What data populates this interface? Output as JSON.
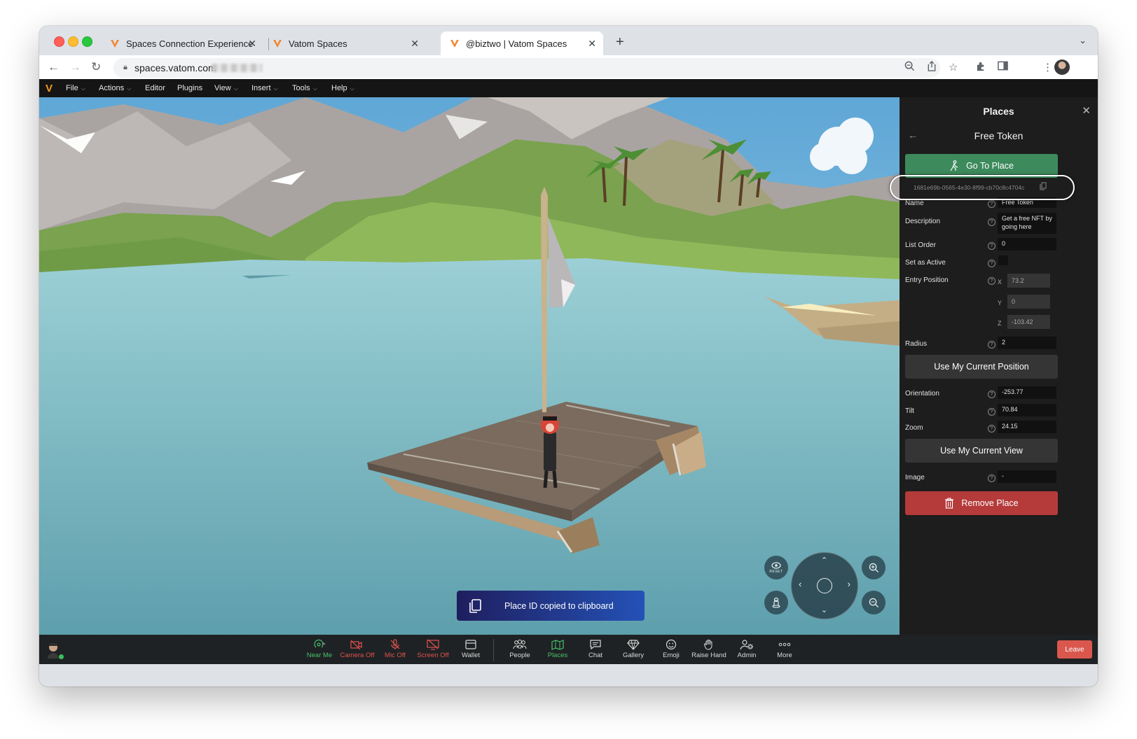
{
  "browser": {
    "tabs": [
      {
        "title": "Spaces Connection Experience",
        "active": false
      },
      {
        "title": "Vatom Spaces",
        "active": false
      },
      {
        "title": "@biztwo | Vatom Spaces",
        "active": true
      }
    ],
    "new_tab_label": "+",
    "url": "spaces.vatom.com"
  },
  "app_menu": {
    "items": [
      "File",
      "Actions",
      "Editor",
      "Plugins",
      "View",
      "Insert",
      "Tools",
      "Help"
    ]
  },
  "toast": {
    "text": "Place ID copied to clipboard"
  },
  "panel": {
    "title": "Places",
    "subtitle": "Free Token",
    "go_button": "Go To Place",
    "place_id": "1681e69b-0565-4e30-8f99-cb70c8c4704c",
    "fields": {
      "name_label": "Name",
      "name_value": "Free Token",
      "description_label": "Description",
      "description_value": "Get a free NFT by going here",
      "list_order_label": "List Order",
      "list_order_value": "0",
      "set_active_label": "Set as Active",
      "entry_position_label": "Entry Position",
      "x_label": "X",
      "x_value": "73.2",
      "y_label": "Y",
      "y_value": "0",
      "z_label": "Z",
      "z_value": "-103.42",
      "radius_label": "Radius",
      "radius_value": "2",
      "orientation_label": "Orientation",
      "orientation_value": "-253.77",
      "tilt_label": "Tilt",
      "tilt_value": "70.84",
      "zoom_label": "Zoom",
      "zoom_value": "24.15",
      "image_label": "Image",
      "image_value": "-"
    },
    "use_position_button": "Use My Current Position",
    "use_view_button": "Use My Current View",
    "remove_button": "Remove Place"
  },
  "bottom_bar": {
    "items": [
      {
        "label": "Near Me",
        "state": "on"
      },
      {
        "label": "Camera Off",
        "state": "off"
      },
      {
        "label": "Mic Off",
        "state": "off"
      },
      {
        "label": "Screen Off",
        "state": "off"
      },
      {
        "label": "Wallet",
        "state": "neutral"
      },
      {
        "label": "People",
        "state": "neutral"
      },
      {
        "label": "Places",
        "state": "on"
      },
      {
        "label": "Chat",
        "state": "neutral"
      },
      {
        "label": "Gallery",
        "state": "neutral"
      },
      {
        "label": "Emoji",
        "state": "neutral"
      },
      {
        "label": "Raise Hand",
        "state": "neutral"
      },
      {
        "label": "Admin",
        "state": "neutral"
      },
      {
        "label": "More",
        "state": "neutral"
      }
    ],
    "leave_button": "Leave"
  },
  "viewport_controls": {
    "reset_label": "RESET"
  },
  "colors": {
    "accent_green": "#3d8a5c",
    "danger_red": "#b53a3a",
    "leave_red": "#d9574d",
    "brand_orange": "#f39a1d"
  }
}
